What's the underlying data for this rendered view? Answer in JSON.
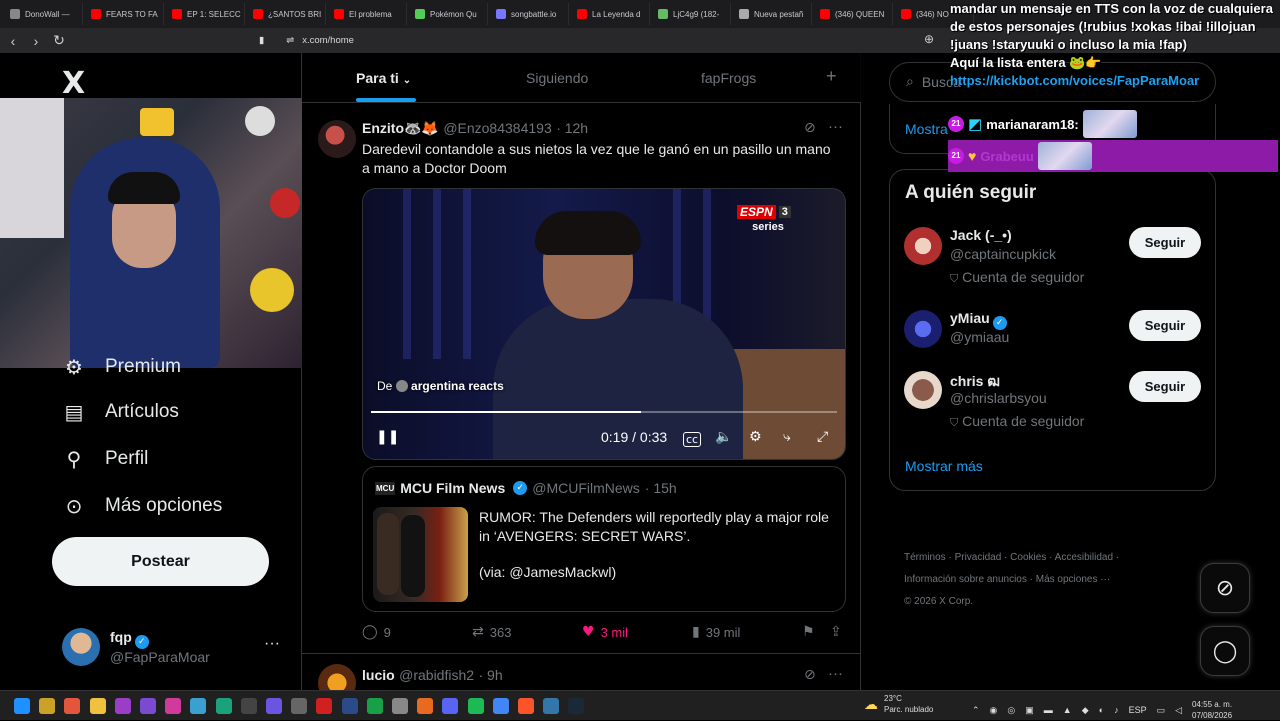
{
  "browser": {
    "tabs": [
      {
        "label": "DonoWall —",
        "color": "#888"
      },
      {
        "label": "FEARS TO FA",
        "color": "#f00"
      },
      {
        "label": "EP 1: SELECC",
        "color": "#f00"
      },
      {
        "label": "¿SANTOS BRI",
        "color": "#f00"
      },
      {
        "label": "El problema",
        "color": "#f00"
      },
      {
        "label": "Pokémon Qu",
        "color": "#5c5"
      },
      {
        "label": "songbattle.io",
        "color": "#77f"
      },
      {
        "label": "La Leyenda d",
        "color": "#f00"
      },
      {
        "label": "LjC4g9 (182-",
        "color": "#6b6"
      },
      {
        "label": "Nueva pestañ",
        "color": "#aaa"
      },
      {
        "label": "(346) QUEEN",
        "color": "#f00"
      },
      {
        "label": "(346) NO",
        "color": "#f00"
      }
    ],
    "url": "x.com/home"
  },
  "sidebar": {
    "logo": "X",
    "nav": [
      {
        "label": "Premium",
        "icon": "premium-icon"
      },
      {
        "label": "Artículos",
        "icon": "articles-icon"
      },
      {
        "label": "Perfil",
        "icon": "profile-icon"
      },
      {
        "label": "Más opciones",
        "icon": "more-icon"
      }
    ],
    "post_button": "Postear",
    "account": {
      "name": "fqp",
      "handle": "@FapParaMoar",
      "more": "···"
    }
  },
  "feed": {
    "tabs": [
      "Para ti",
      "Siguiendo",
      "fapFrogs"
    ],
    "add_tab": "+",
    "tweet1": {
      "name": "Enzito🦝🦊",
      "handle": "@Enzo84384193",
      "time": "· 12h",
      "text": "Daredevil contandole a sus nietos la vez que le ganó en un pasillo un mano a mano a Doctor Doom",
      "video": {
        "brand": "ESPN",
        "channel": "3",
        "series": "series",
        "source_prefix": "De",
        "source": "argentina reacts",
        "time": "0:19 / 0:33",
        "progress": 0.58
      },
      "quote": {
        "logo": "MCU",
        "name": "MCU Film News",
        "handle": "@MCUFilmNews",
        "time": "· 15h",
        "text": "RUMOR: The Defenders will reportedly play a major role in ‘AVENGERS: SECRET WARS’.",
        "via": "(via: @JamesMackwl)"
      },
      "actions": {
        "replies": "9",
        "reposts": "363",
        "likes": "3 mil",
        "views": "39 mil"
      }
    },
    "tweet2": {
      "name": "lucio",
      "handle": "@rabidfish2",
      "time": "· 9h"
    }
  },
  "right": {
    "search_placeholder": "Busca",
    "show_more_top": "Mostra",
    "who_to_follow": "A quién seguir",
    "follow_label": "Seguir",
    "suggestions": [
      {
        "name": "Jack (-_•)",
        "handle": "@captaincupkick",
        "sub": "Cuenta de seguidor",
        "verified": false,
        "color": "#b03030"
      },
      {
        "name": "yMiau",
        "handle": "@ymiaau",
        "sub": "",
        "verified": true,
        "color": "#2234a8"
      },
      {
        "name": "chris ฒ",
        "handle": "@chrislarbsyou",
        "sub": "Cuenta de seguidor",
        "verified": false,
        "color": "#6b4a3a"
      }
    ],
    "show_more": "Mostrar más",
    "footer_line1": [
      "Términos",
      "Privacidad",
      "Cookies",
      "Accesibilidad"
    ],
    "footer_line2": [
      "Información sobre anuncios",
      "Más opciones ···"
    ],
    "copyright": "© 2026 X Corp."
  },
  "overlay": {
    "message": "mandar un mensaje en TTS con la voz de cualquiera de estos personajes (!rubius !xokas !ibai !illojuan !juans !staryuuki o incluso la mia !fap)",
    "list_line": "Aquí la lista entera 🐸👉",
    "link": "https://kickbot.com/voices/FapParaMoar",
    "chat1_badge": "21",
    "chat1_user": "marianaram18:",
    "chat2_badge": "21",
    "chat2_user": "Grabeuu"
  },
  "taskbar": {
    "weather_temp": "23°C",
    "weather_desc": "Parc. nublado",
    "lang": "ESP",
    "time": "04:55 a. m.",
    "date": "07/08/2026"
  }
}
